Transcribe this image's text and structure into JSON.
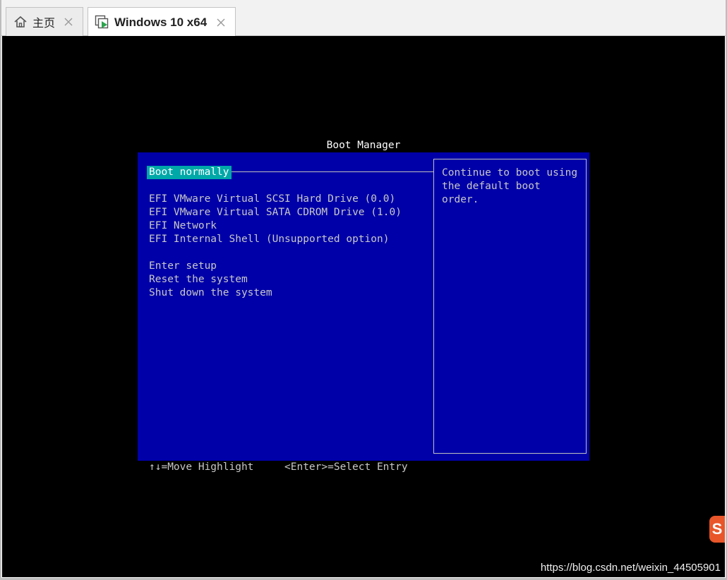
{
  "tabs": [
    {
      "label": "主页",
      "icon": "home-icon",
      "active": false
    },
    {
      "label": "Windows 10 x64",
      "icon": "vm-icon",
      "active": true
    }
  ],
  "boot_manager": {
    "title": "Boot Manager",
    "menu": [
      {
        "label": "Boot normally",
        "selected": true
      },
      {
        "label": "EFI VMware Virtual SCSI Hard Drive (0.0)"
      },
      {
        "label": "EFI VMware Virtual SATA CDROM Drive (1.0)"
      },
      {
        "label": "EFI Network"
      },
      {
        "label": "EFI Internal Shell (Unsupported option)"
      },
      {
        "label": "Enter setup"
      },
      {
        "label": "Reset the system"
      },
      {
        "label": "Shut down the system"
      }
    ],
    "help_text": "Continue to boot using\nthe default boot order.",
    "footer_move": "↑↓=Move Highlight",
    "footer_select": "<Enter>=Select Entry"
  },
  "watermark": "https://blog.csdn.net/weixin_44505901",
  "colors": {
    "panel_bg": "#0000a8",
    "highlight_bg": "#00a8a8",
    "console_bg": "#000000"
  }
}
